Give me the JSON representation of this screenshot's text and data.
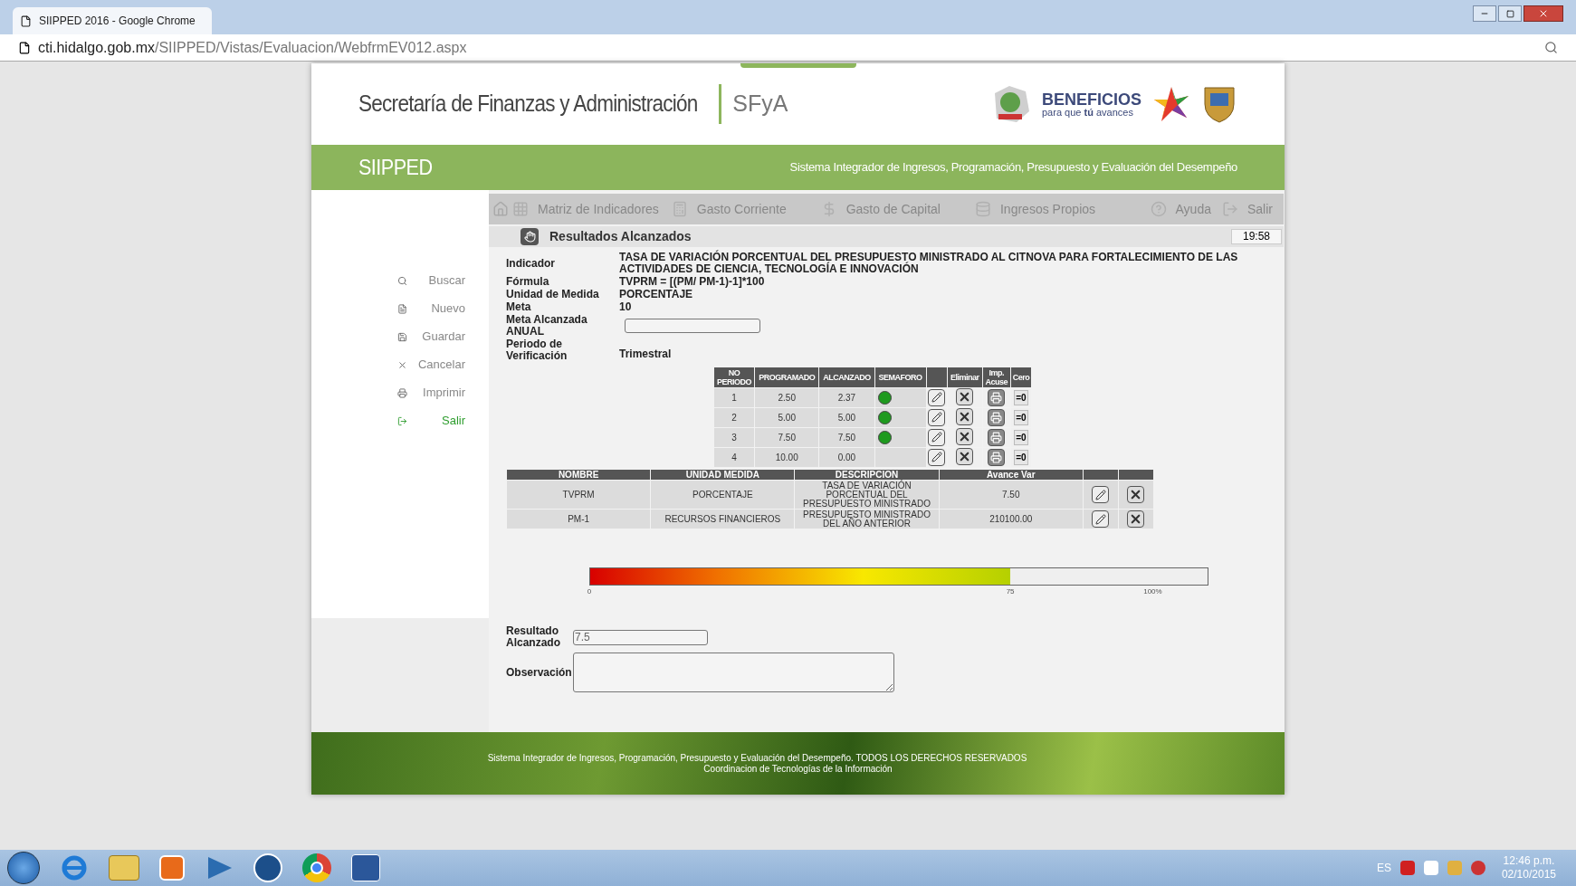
{
  "browser": {
    "tab_title": "SIIPPED 2016 - Google Chrome",
    "url_domain": "cti.hidalgo.gob.mx",
    "url_path": "/SIIPPED/Vistas/Evaluacion/WebfrmEV012.aspx"
  },
  "header": {
    "title": "Secretaría de Finanzas y Administración",
    "short": "SFyA",
    "brand": "BENEFICIOS",
    "slogan": "para que **tú** avances",
    "system": "SIIPPED",
    "system_full": "Sistema Integrador de Ingresos, Programación, Presupuesto y Evaluación del Desempeño"
  },
  "sidebar": {
    "items": [
      {
        "label": "Buscar",
        "selected": false
      },
      {
        "label": "Nuevo",
        "selected": false
      },
      {
        "label": "Guardar",
        "selected": false
      },
      {
        "label": "Cancelar",
        "selected": false
      },
      {
        "label": "Imprimir",
        "selected": false
      },
      {
        "label": "Salir",
        "selected": true
      }
    ]
  },
  "menu": [
    {
      "label": "Matriz de Indicadores"
    },
    {
      "label": "Gasto Corriente"
    },
    {
      "label": "Gasto de Capital"
    },
    {
      "label": "Ingresos Propios"
    },
    {
      "label": "Ayuda"
    },
    {
      "label": "Salir"
    }
  ],
  "section": {
    "title": "Resultados Alcanzados",
    "time": "19:58"
  },
  "fields": [
    {
      "label": "Indicador",
      "value": "TASA DE VARIACIÓN PORCENTUAL DEL PRESUPUESTO MINISTRADO AL CITNOVA PARA FORTALECIMIENTO DE LAS ACTIVIDADES DE CIENCIA, TECNOLOGÍA E INNOVACIÓN",
      "kind": "text"
    },
    {
      "label": "Fórmula",
      "value": "TVPRM = [(PM/ PM-1)-1]*100",
      "kind": "text"
    },
    {
      "label": "Unidad de Medida",
      "value": "PORCENTAJE",
      "kind": "text"
    },
    {
      "label": "Meta",
      "value": "10",
      "kind": "text"
    },
    {
      "label": "Meta Alcanzada ANUAL",
      "kind": "input"
    },
    {
      "label": "Periodo de Verificación",
      "value": "Trimestral",
      "kind": "text"
    }
  ],
  "periods": {
    "columns": [
      "NO PERIODO",
      "PROGRAMADO",
      "ALCANZADO",
      "SEMAFORO",
      "Eliminar",
      "Imp. Acuse",
      "Cero"
    ],
    "rows": [
      {
        "no": "1",
        "programado": "2.50",
        "alcanzado": "2.37",
        "color": "#1e9a1e",
        "cero": "=0"
      },
      {
        "no": "2",
        "programado": "5.00",
        "alcanzado": "5.00",
        "color": "#1e9a1e",
        "cero": "=0"
      },
      {
        "no": "3",
        "programado": "7.50",
        "alcanzado": "7.50",
        "color": "#1e9a1e",
        "cero": "=0"
      },
      {
        "no": "4",
        "programado": "10.00",
        "alcanzado": "0.00",
        "cero": "=0"
      }
    ]
  },
  "variables": {
    "columns": [
      "NOMBRE",
      "UNIDAD MEDIDA",
      "DESCRIPCION",
      "Avance Var"
    ],
    "rows": [
      {
        "nombre": "TVPRM",
        "unidad": "PORCENTAJE",
        "descripcion": "TASA DE VARIACIÓN PORCENTUAL DEL PRESUPUESTO MINISTRADO",
        "avance": "7.50"
      },
      {
        "nombre": "PM-1",
        "unidad": "RECURSOS FINANCIEROS",
        "descripcion": "PRESUPUESTO MINISTRADO DEL AÑO ANTERIOR",
        "avance": "210100.00"
      }
    ]
  },
  "gauge": {
    "level": 0.68,
    "ticks": [
      "0",
      "75",
      "100%"
    ]
  },
  "result": {
    "label": "Resultado Alcanzado",
    "value": "7.5"
  },
  "observation": {
    "label": "Observación"
  },
  "footer": {
    "line1": "Sistema Integrador de Ingresos, Programación, Presupuesto y Evaluación del Desempeño. TODOS LOS DERECHOS RESERVADOS",
    "line2": "Coordinacion de Tecnologías de la Información"
  },
  "taskbar": {
    "language": "ES",
    "time": "12:46 p.m.",
    "date": "02/10/2015"
  }
}
